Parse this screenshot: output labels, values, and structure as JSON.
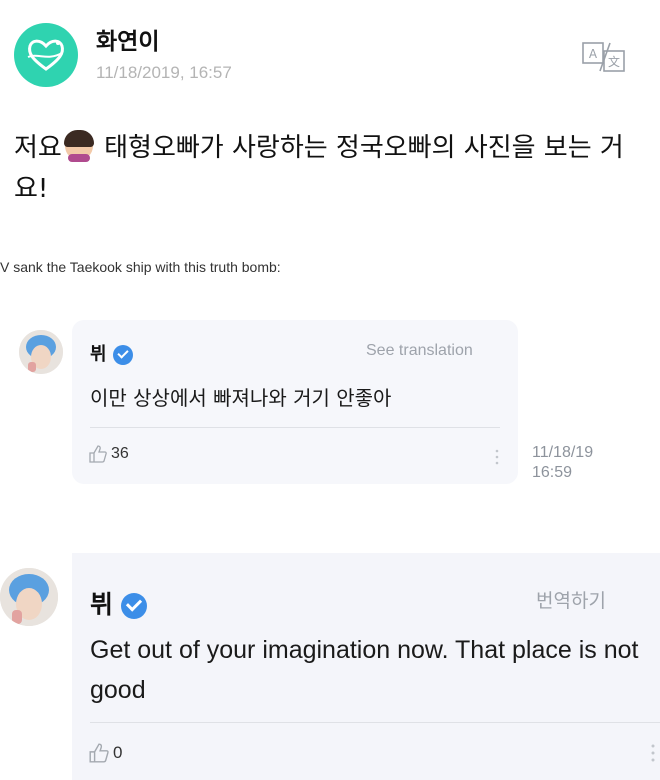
{
  "post": {
    "username": "화연이",
    "timestamp": "11/18/2019, 16:57",
    "text_part1": "저요",
    "text_part2": " 태형오빠가 사랑하는 정국오빠의 사진을 보는 거요!",
    "emoji": "raising-hand-emoji"
  },
  "caption": "V sank the Taekook ship with this truth bomb:",
  "comment1": {
    "name": "뷔",
    "translate_label": "See translation",
    "text": "이만 상상에서 빠져나와 거기 안좋아",
    "likes": "36",
    "time_date": "11/18/19",
    "time_clock": "16:59"
  },
  "comment2": {
    "name": "뷔",
    "translate_label": "번역하기",
    "text": "Get out of your imagination now. That place is not good",
    "likes": "0"
  },
  "colors": {
    "avatar_bg": "#2fd3b0",
    "verified": "#3c8ee8",
    "card_bg": "#f6f7fb"
  }
}
